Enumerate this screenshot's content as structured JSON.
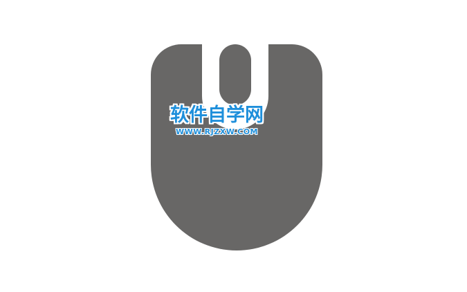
{
  "canvas": {
    "background": "#ffffff"
  },
  "icon": {
    "name": "mouse-icon",
    "body_color": "#686766",
    "slot_color": "#ffffff"
  },
  "watermark": {
    "title": "软件自学网",
    "url": "WWW.RJZXW.COM",
    "color": "#1e8fdb"
  }
}
